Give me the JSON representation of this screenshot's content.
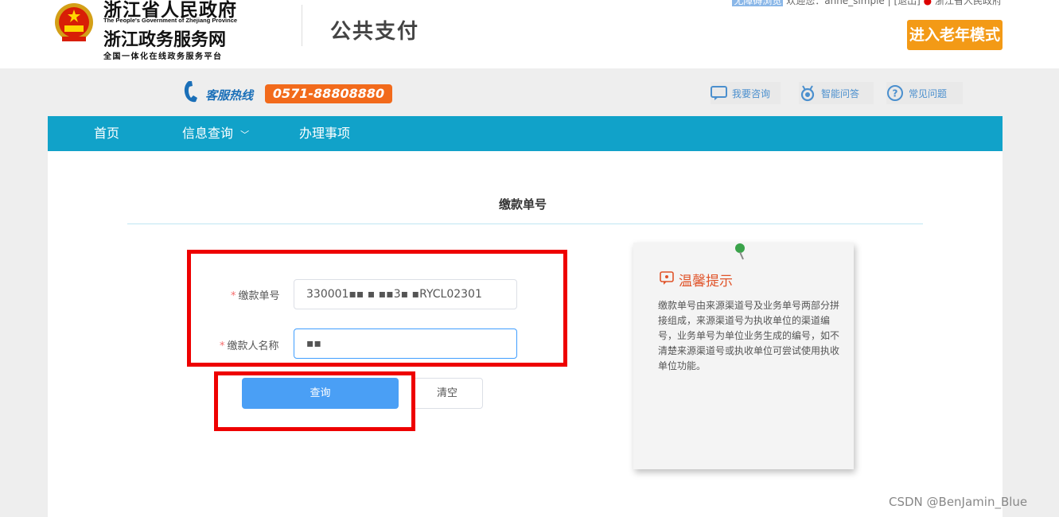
{
  "header": {
    "gov_name_cn": "浙江省人民政府",
    "gov_name_en": "The People's Government of Zhejiang Province",
    "service_net": "浙江政务服务网",
    "platform": "全国一体化在线政务服务平台",
    "page_title": "公共支付",
    "user": {
      "highlight": "无障碍浏览",
      "welcome": "欢迎您：anne_simple",
      "logout": "[退出]",
      "region": "浙江省人民政府"
    },
    "elder_mode_button": "进入老年模式"
  },
  "service_bar": {
    "hotline_label": "客服热线",
    "hotline_number": "0571-88808880",
    "tools": [
      {
        "icon": "chat-bubble-icon",
        "label": "我要咨询"
      },
      {
        "icon": "robot-icon",
        "label": "智能问答"
      },
      {
        "icon": "question-circle-icon",
        "label": "常见问题"
      }
    ]
  },
  "nav": {
    "items": [
      {
        "label": "首页"
      },
      {
        "label": "信息查询",
        "dropdown": true
      },
      {
        "label": "办理事项"
      }
    ]
  },
  "main": {
    "section_title": "缴款单号",
    "form": {
      "fields": [
        {
          "label": "缴款单号",
          "required_mark": "*",
          "value": "330001▪▪ ▪ ▪▪3▪ ▪RYCL02301"
        },
        {
          "label": "缴款人名称",
          "required_mark": "*",
          "value": "▪▪"
        }
      ],
      "query_button": "查询",
      "clear_button": "清空"
    },
    "tip": {
      "title": "温馨提示",
      "body": "缴款单号由来源渠道号及业务单号两部分拼接组成，来源渠道号为执收单位的渠道编号，业务单号为单位业务生成的编号，如不清楚来源渠道号或执收单位可尝试使用执收单位功能。"
    }
  },
  "watermark": "CSDN @BenJamin_Blue",
  "colors": {
    "nav_bg": "#11a2c9",
    "elder_btn": "#f39a16",
    "hotline_bg": "#f26a1b",
    "primary_btn": "#4a9ff5",
    "annotation_red": "#ee0000",
    "tip_title": "#e0542a"
  }
}
